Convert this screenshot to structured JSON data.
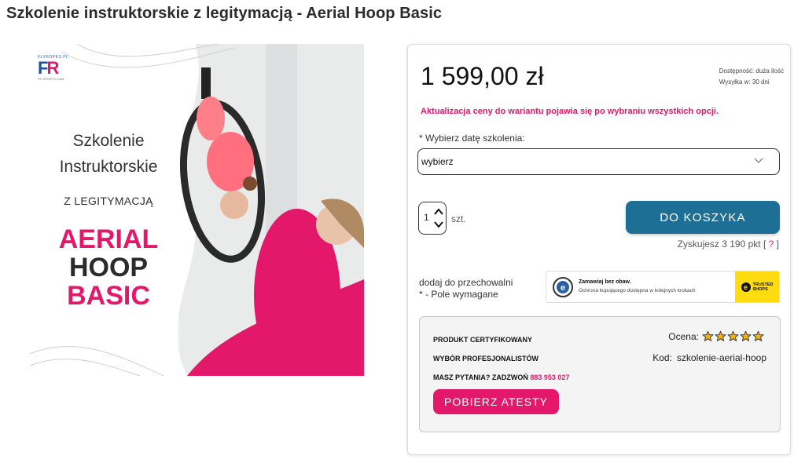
{
  "page": {
    "title": "Szkolenie instruktorskie z legitymacją - Aerial Hoop Basic"
  },
  "product_image": {
    "logo_top": "FLYROPES.PL",
    "logo_mark_left": "F",
    "logo_mark_right": "R",
    "logo_bottom": "FR SPORTS.COM",
    "line1": "Szkolenie",
    "line2": "Instruktorskie",
    "line3": "Z LEGITYMACJĄ",
    "line4": "AERIAL",
    "line5": "HOOP",
    "line6": "BASIC"
  },
  "buy_box": {
    "price": "1 599,00 zł",
    "availability_label": "Dostępność:",
    "availability_value": "duża ilość",
    "shipping_label": "Wysyłka w:",
    "shipping_value": "30 dni",
    "price_notice": "Aktualizacja ceny do wariantu pojawia się po wybraniu wszystkich opcji.",
    "date_label": "* Wybierz datę szkolenia:",
    "date_select_value": "wybierz",
    "quantity_value": "1",
    "quantity_unit": "szt.",
    "add_to_cart_label": "DO KOSZYKA",
    "points_text": "Zyskujesz 3 190 pkt [",
    "points_help": "?",
    "points_close": "]",
    "wishlist_label": "dodaj do przechowalni",
    "required_note": "* - Pole wymagane"
  },
  "trusted_shops": {
    "heading": "Zamawiaj bez obaw.",
    "subtext": "Ochrona kupującego dostępna w kolejnych krokach",
    "badge_text_1": "TRUSTED",
    "badge_text_2": "SHOPS",
    "seal_letter": "e"
  },
  "info_box": {
    "line1": "PRODUKT CERTYFIKOWANY",
    "line2": "WYBÓR PROFESJONALISTÓW",
    "line3_text": "MASZ PYTANIA? ZADZWOŃ",
    "line3_phone": "883 953 027",
    "rating_label": "Ocena:",
    "rating_value": 5,
    "rating_max": 5,
    "code_label": "Kod:",
    "code_value": "szkolenie-aerial-hoop",
    "download_button": "POBIERZ ATESTY"
  },
  "colors": {
    "accent_pink": "#e3186a",
    "cart_blue": "#1e6f96",
    "trusted_yellow": "#ffdc0f",
    "star_yellow": "#f5b400"
  },
  "icons": [
    "chevron-down-icon",
    "chevron-up-icon",
    "star-icon",
    "trusted-shops-seal-icon"
  ]
}
